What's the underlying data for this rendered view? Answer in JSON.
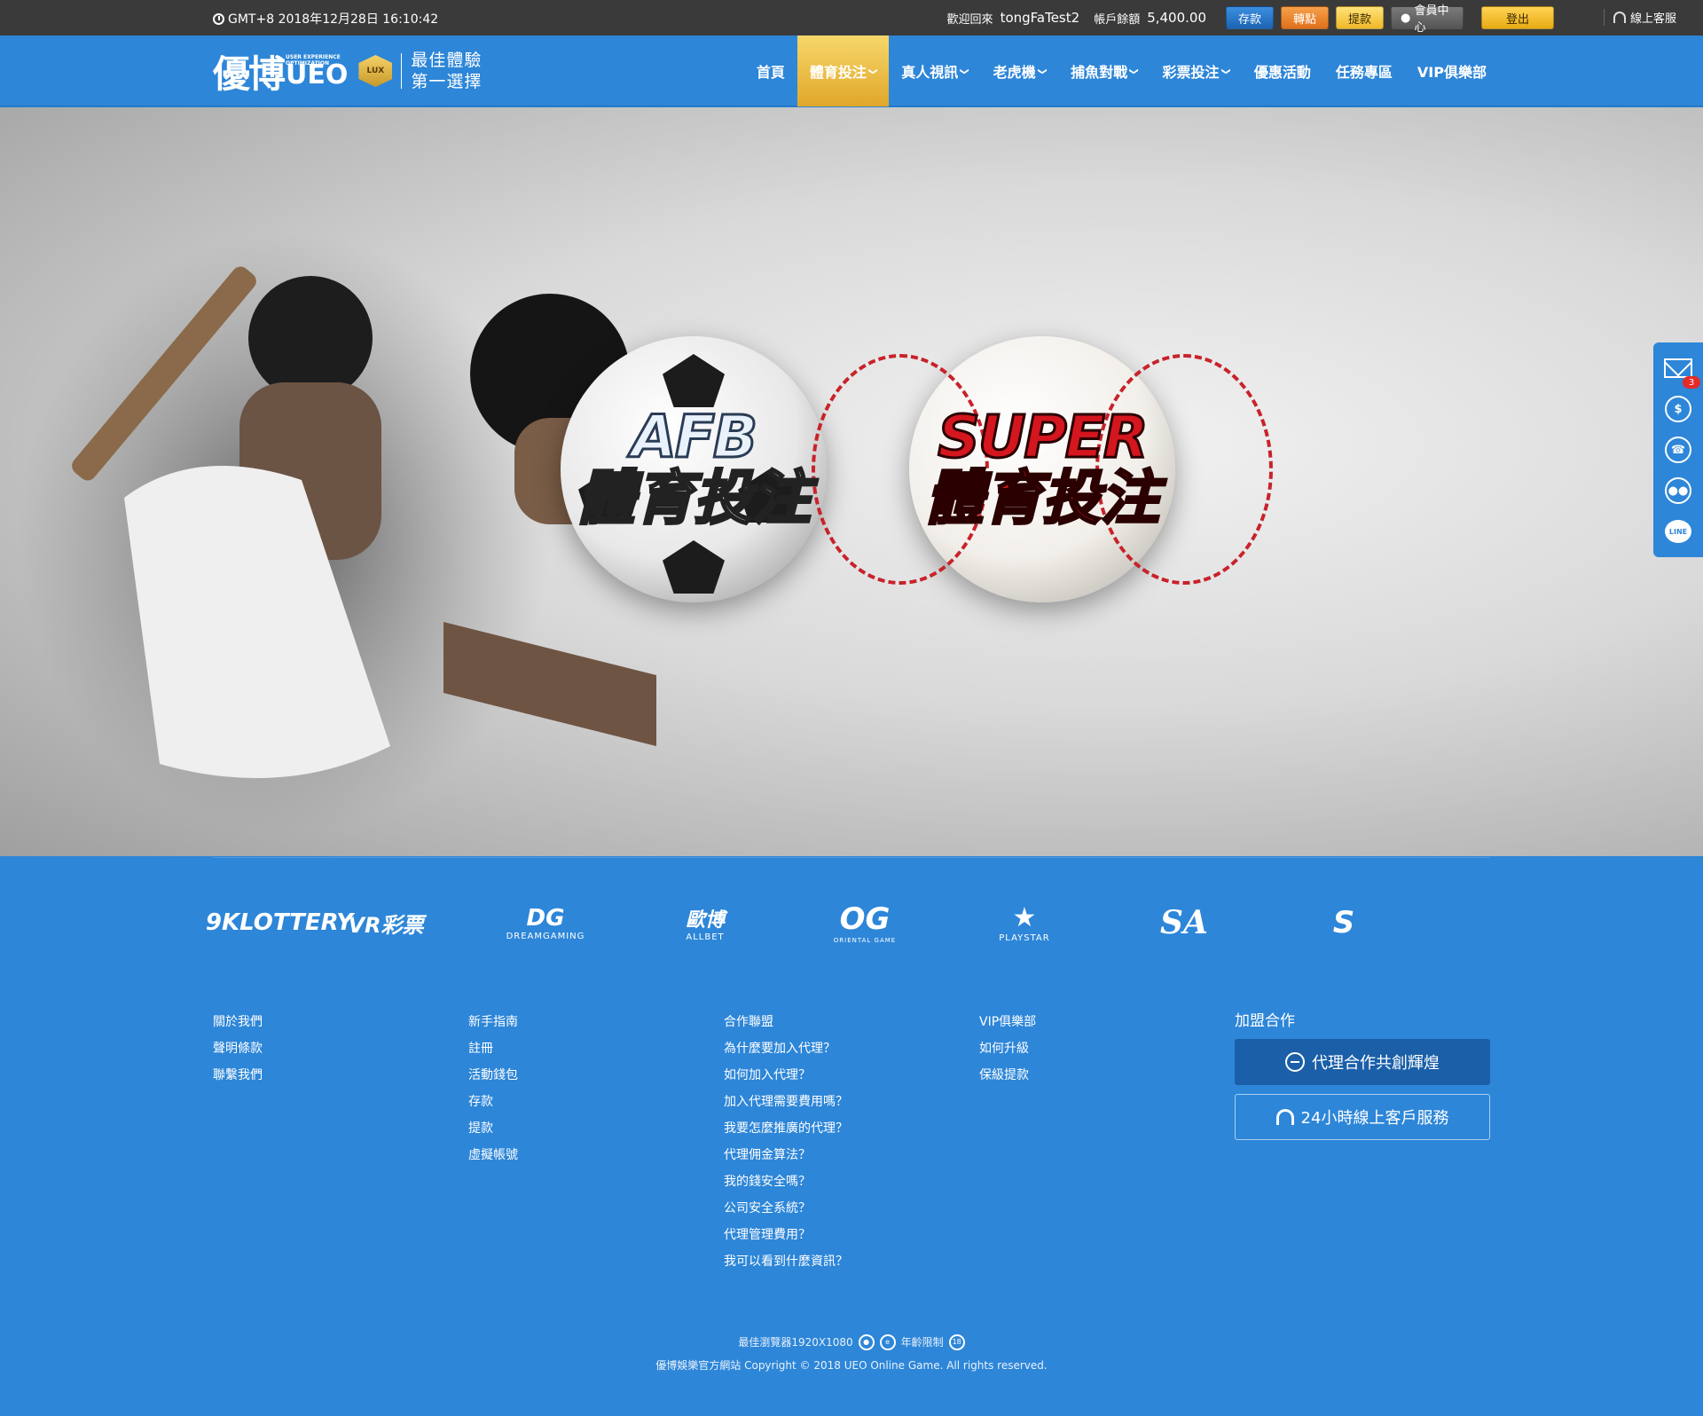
{
  "topbar": {
    "clock": "GMT+8 2018年12月28日 16:10:42",
    "welcome": "歡迎回來",
    "username": "tongFaTest2",
    "balance_label": "帳戶餘額",
    "balance": "5,400.00",
    "buttons": {
      "deposit": "存款",
      "transfer": "轉點",
      "withdraw": "提款",
      "member": "會員中心",
      "logout": "登出"
    },
    "support": "線上客服"
  },
  "header": {
    "logo_cn": "優博",
    "logo_en": "UEO",
    "logo_small": "USER EXPERIENCE OPTIMIZATION",
    "logo_badge": "LUX",
    "slogan_line1": "最佳體驗",
    "slogan_line2": "第一選擇"
  },
  "nav": {
    "items": [
      {
        "label": "首頁",
        "dropdown": false
      },
      {
        "label": "體育投注",
        "dropdown": true,
        "active": true
      },
      {
        "label": "真人視訊",
        "dropdown": true
      },
      {
        "label": "老虎機",
        "dropdown": true
      },
      {
        "label": "捕魚對戰",
        "dropdown": true
      },
      {
        "label": "彩票投注",
        "dropdown": true
      },
      {
        "label": "優惠活動",
        "dropdown": false
      },
      {
        "label": "任務專區",
        "dropdown": false
      },
      {
        "label": "VIP俱樂部",
        "dropdown": false
      }
    ]
  },
  "banner": {
    "afb_title": "AFB",
    "afb_sub": "體育投注",
    "super_title": "SUPER",
    "super_sub": "體育投注"
  },
  "sidebar": {
    "mail_badge": "3",
    "money_symbol": "$",
    "line_label": "LINE"
  },
  "providers": [
    {
      "name": "9KLOTTERY",
      "sub": ""
    },
    {
      "name": "VR彩票",
      "sub": ""
    },
    {
      "name": "DG",
      "sub": "DREAMGAMING"
    },
    {
      "name": "歐博",
      "sub": "ALLBET"
    },
    {
      "name": "OG",
      "sub": "ORIENTAL GAME"
    },
    {
      "name": "★",
      "sub": "PLAYSTAR"
    },
    {
      "name": "SA",
      "sub": ""
    },
    {
      "name": "S",
      "sub": ""
    }
  ],
  "footer": {
    "col1": [
      "關於我們",
      "聲明條款",
      "聯繫我們"
    ],
    "col2": [
      "新手指南",
      "註冊",
      "活動錢包",
      "存款",
      "提款",
      "虛擬帳號"
    ],
    "col3": [
      "合作聯盟",
      "為什麼要加入代理？",
      "如何加入代理？",
      "加入代理需要費用嗎？",
      "我要怎麼推廣的代理？",
      "代理佣金算法？",
      "我的錢安全嗎？",
      "公司安全系統？",
      "代理管理費用？",
      "我可以看到什麼資訊？"
    ],
    "col4": [
      "VIP俱樂部",
      "如何升級",
      "保級提款"
    ],
    "join_title": "加盟合作",
    "agent_button": "代理合作共創輝煌",
    "service_button": "24小時線上客戶服務"
  },
  "copyright": {
    "browser": "最佳瀏覽器1920X1080",
    "age": "年齡限制",
    "age_badge": "18",
    "line": "優博娛樂官方網站 Copyright © 2018 UEO Online Game. All rights reserved."
  }
}
